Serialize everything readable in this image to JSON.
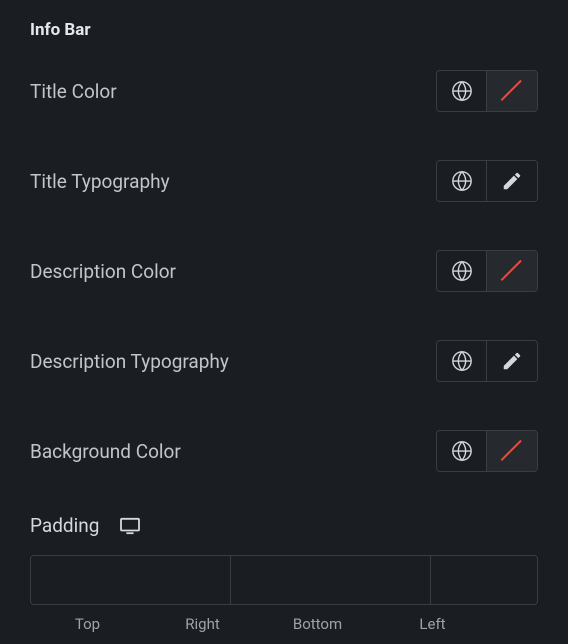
{
  "section": {
    "title": "Info Bar"
  },
  "controls": {
    "titleColor": {
      "label": "Title Color"
    },
    "titleTypography": {
      "label": "Title Typography"
    },
    "descriptionColor": {
      "label": "Description Color"
    },
    "descriptionTypography": {
      "label": "Description Typography"
    },
    "backgroundColor": {
      "label": "Background Color"
    }
  },
  "padding": {
    "label": "Padding",
    "sides": {
      "top": {
        "label": "Top",
        "value": ""
      },
      "right": {
        "label": "Right",
        "value": ""
      },
      "bottom": {
        "label": "Bottom",
        "value": ""
      },
      "left": {
        "label": "Left",
        "value": ""
      }
    }
  }
}
